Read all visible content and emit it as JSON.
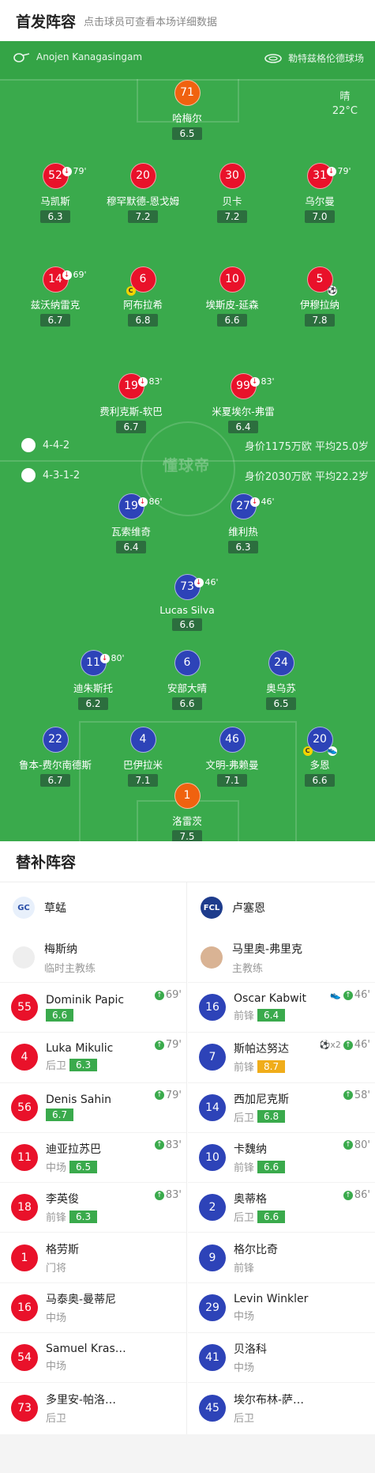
{
  "header": {
    "title": "首发阵容",
    "subtitle": "点击球员可查看本场详细数据"
  },
  "match": {
    "referee": "Anojen Kanagasingam",
    "venue": "勒特兹格伦德球场",
    "weather": "晴",
    "temperature": "22°C"
  },
  "watermark": "懂球帝",
  "home_team_info": {
    "formation": "4-4-2",
    "stats": "身价1175万欧 平均25.0岁"
  },
  "away_team_info": {
    "formation": "4-3-1-2",
    "stats": "身价2030万欧 平均22.2岁"
  },
  "home_lineup": [
    {
      "num": "71",
      "name": "哈梅尔",
      "rating": "6.5",
      "color": "orange"
    },
    {
      "num": "52",
      "name": "马凯斯",
      "rating": "6.3",
      "color": "red",
      "sub": "79'"
    },
    {
      "num": "20",
      "name": "穆罕默德-恩戈姆",
      "rating": "7.2",
      "color": "red"
    },
    {
      "num": "30",
      "name": "贝卡",
      "rating": "7.2",
      "color": "red"
    },
    {
      "num": "31",
      "name": "乌尔曼",
      "rating": "7.0",
      "color": "red",
      "sub": "79'"
    },
    {
      "num": "14",
      "name": "兹沃纳雷克",
      "rating": "6.7",
      "color": "red",
      "sub": "69'"
    },
    {
      "num": "6",
      "name": "阿布拉希",
      "rating": "6.8",
      "color": "red",
      "captain": true
    },
    {
      "num": "10",
      "name": "埃斯皮-延森",
      "rating": "6.6",
      "color": "red"
    },
    {
      "num": "5",
      "name": "伊穆拉纳",
      "rating": "7.8",
      "color": "red",
      "goal": true
    },
    {
      "num": "19",
      "name": "费利克斯-软巴",
      "rating": "6.7",
      "color": "red",
      "sub": "83'"
    },
    {
      "num": "99",
      "name": "米夏埃尔-弗雷",
      "rating": "6.4",
      "color": "red",
      "sub": "83'"
    }
  ],
  "away_lineup": [
    {
      "num": "19",
      "name": "瓦索维奇",
      "rating": "6.4",
      "color": "blue",
      "sub": "86'"
    },
    {
      "num": "27",
      "name": "维利热",
      "rating": "6.3",
      "color": "blue",
      "sub": "46'"
    },
    {
      "num": "73",
      "name": "Lucas Silva",
      "rating": "6.6",
      "color": "blue",
      "sub": "46'"
    },
    {
      "num": "11",
      "name": "迪朱斯托",
      "rating": "6.2",
      "color": "blue",
      "sub": "80'"
    },
    {
      "num": "6",
      "name": "安部大晴",
      "rating": "6.6",
      "color": "blue"
    },
    {
      "num": "24",
      "name": "奥乌苏",
      "rating": "6.5",
      "color": "blue"
    },
    {
      "num": "22",
      "name": "鲁本-费尔南德斯",
      "rating": "6.7",
      "color": "blue"
    },
    {
      "num": "4",
      "name": "巴伊拉米",
      "rating": "7.1",
      "color": "blue"
    },
    {
      "num": "46",
      "name": "文明-弗赖曼",
      "rating": "7.1",
      "color": "blue"
    },
    {
      "num": "20",
      "name": "多恩",
      "rating": "6.6",
      "color": "blue",
      "captain": true,
      "assist": true
    },
    {
      "num": "1",
      "name": "洛雷茨",
      "rating": "7.5",
      "color": "orange"
    }
  ],
  "bench": {
    "title": "替补阵容",
    "home": {
      "team": "草蜢",
      "coach": {
        "name": "梅斯纳",
        "role": "临时主教练"
      },
      "players": [
        {
          "num": "55",
          "name": "Dominik Papic",
          "pos": "",
          "rating": "6.6",
          "min": "69'"
        },
        {
          "num": "4",
          "name": "Luka Mikulic",
          "pos": "后卫",
          "rating": "6.3",
          "min": "79'"
        },
        {
          "num": "56",
          "name": "Denis Sahin",
          "pos": "",
          "rating": "6.7",
          "min": "79'"
        },
        {
          "num": "11",
          "name": "迪亚拉苏巴",
          "pos": "中场",
          "rating": "6.5",
          "min": "83'"
        },
        {
          "num": "18",
          "name": "李英俊",
          "pos": "前锋",
          "rating": "6.3",
          "min": "83'"
        },
        {
          "num": "1",
          "name": "格劳斯",
          "pos": "门将",
          "rating": "",
          "min": ""
        },
        {
          "num": "16",
          "name": "马泰奥-曼蒂尼",
          "pos": "中场",
          "rating": "",
          "min": ""
        },
        {
          "num": "54",
          "name": "Samuel Kras…",
          "pos": "中场",
          "rating": "",
          "min": ""
        },
        {
          "num": "73",
          "name": "多里安-帕洛…",
          "pos": "后卫",
          "rating": "",
          "min": ""
        }
      ]
    },
    "away": {
      "team": "卢塞恩",
      "coach": {
        "name": "马里奥-弗里克",
        "role": "主教练"
      },
      "players": [
        {
          "num": "16",
          "name": "Oscar Kabwit",
          "pos": "前锋",
          "rating": "6.4",
          "min": "46'",
          "extra": "assist"
        },
        {
          "num": "7",
          "name": "斯帕达努达",
          "pos": "前锋",
          "rating": "8.7",
          "rating_color": "yellow",
          "min": "46'",
          "extra": "⚽x2"
        },
        {
          "num": "14",
          "name": "西加尼克斯",
          "pos": "后卫",
          "rating": "6.8",
          "min": "58'"
        },
        {
          "num": "10",
          "name": "卡魏纳",
          "pos": "前锋",
          "rating": "6.6",
          "min": "80'"
        },
        {
          "num": "2",
          "name": "奥蒂格",
          "pos": "后卫",
          "rating": "6.6",
          "min": "86'"
        },
        {
          "num": "9",
          "name": "格尔比奇",
          "pos": "前锋",
          "rating": "",
          "min": ""
        },
        {
          "num": "29",
          "name": "Levin Winkler",
          "pos": "中场",
          "rating": "",
          "min": ""
        },
        {
          "num": "41",
          "name": "贝洛科",
          "pos": "中场",
          "rating": "",
          "min": ""
        },
        {
          "num": "45",
          "name": "埃尔布林-萨…",
          "pos": "后卫",
          "rating": "",
          "min": ""
        }
      ]
    }
  }
}
